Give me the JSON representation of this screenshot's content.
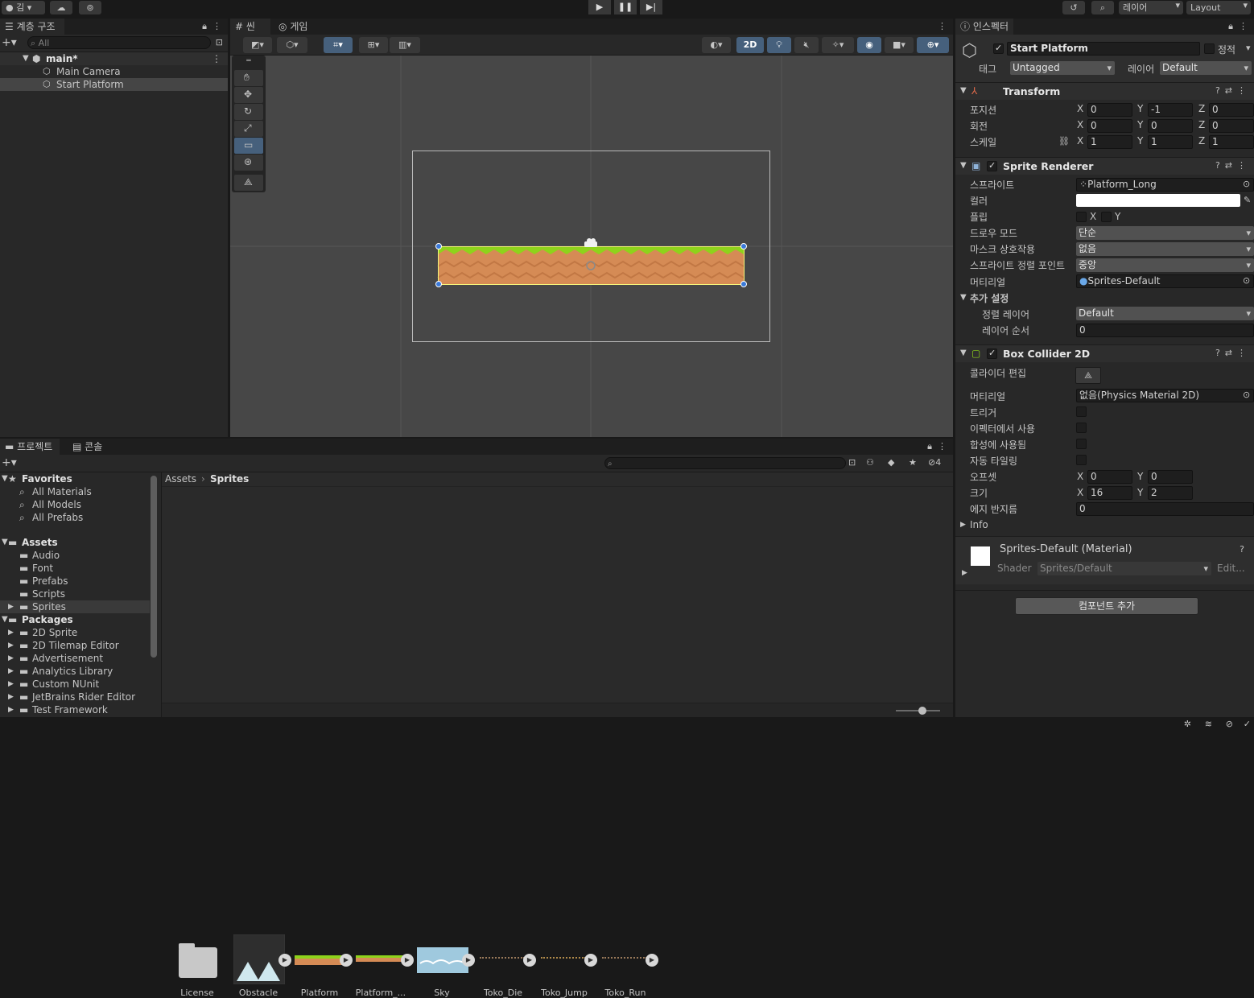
{
  "toolbar": {
    "account_label": "김",
    "layers_label": "레이어",
    "layout_label": "Layout"
  },
  "hierarchy": {
    "tab_label": "계층 구조",
    "search_placeholder": "All",
    "scene_name": "main*",
    "items": [
      {
        "label": "Main Camera"
      },
      {
        "label": "Start Platform"
      }
    ]
  },
  "scene": {
    "tab_scene": "씬",
    "tab_game": "게임",
    "mode_2d": "2D"
  },
  "project": {
    "tab_project": "프로젝트",
    "tab_console": "콘솔",
    "hidden_count": "4",
    "favorites_label": "Favorites",
    "favorites": [
      "All Materials",
      "All Models",
      "All Prefabs"
    ],
    "assets_label": "Assets",
    "assets_folders": [
      "Audio",
      "Font",
      "Prefabs",
      "Scripts",
      "Sprites"
    ],
    "packages_label": "Packages",
    "packages": [
      "2D Sprite",
      "2D Tilemap Editor",
      "Advertisement",
      "Analytics Library",
      "Custom NUnit",
      "JetBrains Rider Editor",
      "Test Framework"
    ],
    "breadcrumb": [
      "Assets",
      "Sprites"
    ],
    "grid_assets": [
      "License",
      "Obstacle",
      "Platform",
      "Platform_...",
      "Sky",
      "Toko_Die",
      "Toko_Jump",
      "Toko_Run"
    ]
  },
  "inspector": {
    "tab_label": "인스펙터",
    "object_name": "Start Platform",
    "static_label": "정적",
    "tag_label": "태그",
    "tag_value": "Untagged",
    "layer_label": "레이어",
    "layer_value": "Default",
    "transform": {
      "title": "Transform",
      "position_label": "포지션",
      "rotation_label": "회전",
      "scale_label": "스케일",
      "position": [
        "0",
        "-1",
        "0"
      ],
      "rotation": [
        "0",
        "0",
        "0"
      ],
      "scale": [
        "1",
        "1",
        "1"
      ]
    },
    "sprite_renderer": {
      "title": "Sprite Renderer",
      "sprite_label": "스프라이트",
      "sprite_value": "Platform_Long",
      "color_label": "컬러",
      "color_value": "#ffffff",
      "flip_label": "플립",
      "draw_mode_label": "드로우 모드",
      "draw_mode_value": "단순",
      "mask_label": "마스크 상호작용",
      "mask_value": "없음",
      "sort_point_label": "스프라이트 정렬 포인트",
      "sort_point_value": "중앙",
      "material_label": "머티리얼",
      "material_value": "Sprites-Default",
      "additional_label": "추가 설정",
      "sorting_layer_label": "정렬 레이어",
      "sorting_layer_value": "Default",
      "order_label": "레이어 순서",
      "order_value": "0"
    },
    "box_collider": {
      "title": "Box Collider 2D",
      "edit_label": "콜라이더 편집",
      "material_label": "머티리얼",
      "material_value": "없음(Physics Material 2D)",
      "trigger_label": "트리거",
      "effector_label": "이펙터에서 사용",
      "composite_label": "합성에 사용됨",
      "autotile_label": "자동 타일링",
      "offset_label": "오프셋",
      "offset": [
        "0",
        "0"
      ],
      "size_label": "크기",
      "size": [
        "16",
        "2"
      ],
      "edge_label": "에지 반지름",
      "edge_value": "0",
      "info_label": "Info"
    },
    "material": {
      "title": "Sprites-Default (Material)",
      "shader_label": "Shader",
      "shader_value": "Sprites/Default",
      "edit_label": "Edit..."
    },
    "add_component": "컴포넌트 추가"
  },
  "colors": {
    "accent": "#3a79bb",
    "grass": "#8ed31b",
    "dirt": "#d58b55"
  }
}
